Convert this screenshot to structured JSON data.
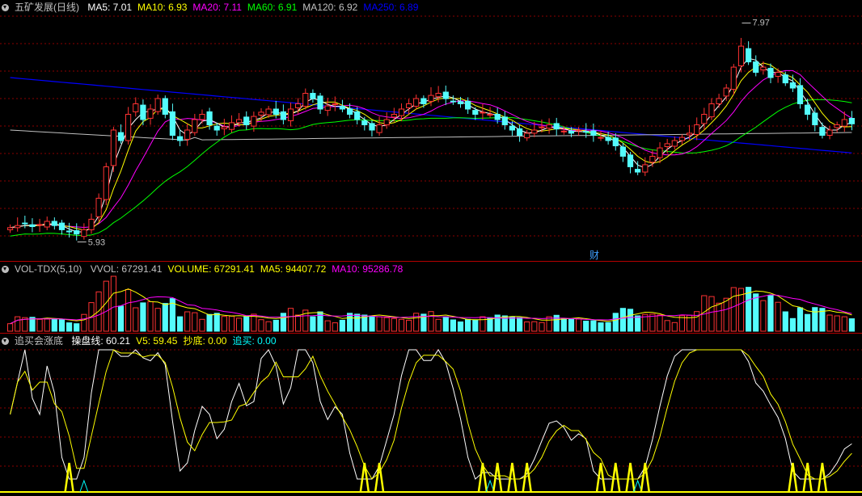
{
  "main_panel": {
    "title": "五矿发展(日线)",
    "ma": [
      {
        "label": "MA5: 7.01",
        "color": "#ffffff"
      },
      {
        "label": "MA10: 6.93",
        "color": "#ffff00"
      },
      {
        "label": "MA20: 7.11",
        "color": "#ff00ff"
      },
      {
        "label": "MA60: 6.91",
        "color": "#00ff00"
      },
      {
        "label": "MA120: 6.92",
        "color": "#c0c0c0"
      },
      {
        "label": "MA250: 6.89",
        "color": "#0000ff"
      }
    ],
    "high_label": "7.97",
    "low_label": "5.93",
    "finance_marker": "财"
  },
  "volume_panel": {
    "name": "VOL-TDX(5,10)",
    "items": [
      {
        "label": "VVOL: 67291.41",
        "color": "#c0c0c0"
      },
      {
        "label": "VOLUME: 67291.41",
        "color": "#ffff00"
      },
      {
        "label": "MA5: 94407.72",
        "color": "#ffff00"
      },
      {
        "label": "MA10: 95286.78",
        "color": "#ff00ff"
      }
    ]
  },
  "indicator_panel": {
    "name": "追买会涨底",
    "items": [
      {
        "label": "操盘线: 60.21",
        "color": "#ffffff"
      },
      {
        "label": "V5: 59.45",
        "color": "#ffff00"
      },
      {
        "label": "抄底: 0.00",
        "color": "#ffff00"
      },
      {
        "label": "追买: 0.00",
        "color": "#00ffff"
      }
    ]
  },
  "colors": {
    "up": "#ff3232",
    "down": "#54fcfc",
    "grid": "#8b0000"
  },
  "chart_data": {
    "type": "candlestick",
    "price_range": [
      5.93,
      7.97
    ],
    "closes": [
      6.02,
      6.04,
      6.06,
      6.03,
      6.05,
      6.08,
      6.04,
      6.0,
      5.98,
      5.96,
      6.0,
      6.1,
      6.3,
      6.6,
      6.95,
      6.85,
      7.1,
      7.2,
      7.05,
      7.15,
      7.25,
      7.1,
      6.9,
      6.85,
      6.95,
      7.05,
      7.1,
      7.0,
      6.95,
      6.98,
      7.02,
      7.05,
      7.0,
      7.08,
      7.12,
      7.15,
      7.1,
      7.05,
      7.15,
      7.2,
      7.3,
      7.25,
      7.15,
      7.18,
      7.2,
      7.15,
      7.1,
      7.05,
      7.0,
      6.95,
      7.0,
      7.05,
      7.1,
      7.15,
      7.2,
      7.25,
      7.2,
      7.28,
      7.3,
      7.25,
      7.22,
      7.2,
      7.15,
      7.1,
      7.12,
      7.1,
      7.05,
      7.0,
      6.95,
      6.9,
      6.92,
      6.95,
      6.98,
      7.0,
      6.96,
      6.94,
      6.92,
      6.95,
      6.93,
      6.9,
      6.88,
      6.85,
      6.8,
      6.7,
      6.6,
      6.55,
      6.62,
      6.7,
      6.78,
      6.82,
      6.85,
      6.88,
      6.92,
      7.0,
      7.1,
      7.2,
      7.25,
      7.35,
      7.55,
      7.75,
      7.6,
      7.5,
      7.55,
      7.45,
      7.5,
      7.4,
      7.35,
      7.2,
      7.1,
      7.0,
      6.9,
      6.95,
      7.0,
      7.05,
      7.01
    ]
  }
}
